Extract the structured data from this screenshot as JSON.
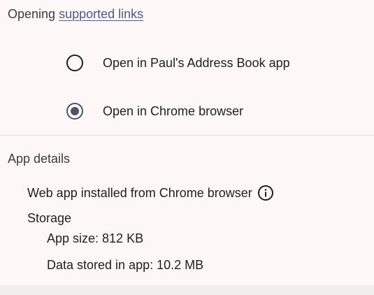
{
  "opening": {
    "title_prefix": "Opening ",
    "title_link": "supported links",
    "options": [
      {
        "label": "Open in Paul's Address Book app",
        "selected": false
      },
      {
        "label": "Open in Chrome browser",
        "selected": true
      }
    ]
  },
  "app_details": {
    "title": "App details",
    "installed_from": "Web app installed from Chrome browser",
    "info_icon": "info-icon",
    "storage_label": "Storage",
    "app_size": "App size: 812 KB",
    "data_stored": "Data stored in app: 10.2 MB"
  },
  "colors": {
    "background": "#fdf8f7",
    "link": "#4a5c85",
    "radio_selected": "#4b5563",
    "divider": "#dedad9"
  }
}
